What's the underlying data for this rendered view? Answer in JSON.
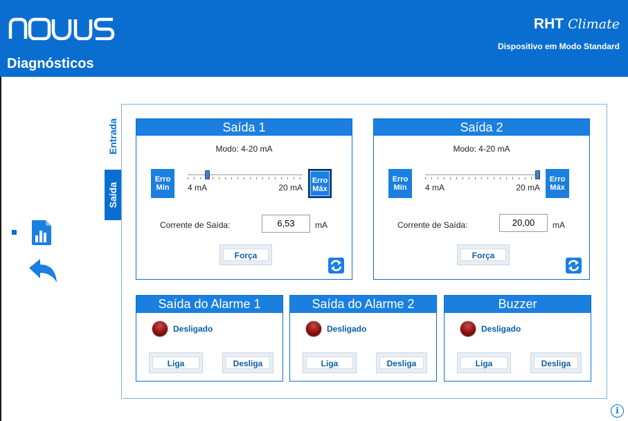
{
  "header": {
    "logo_text": "NOVUS",
    "page_title": "Diagnósticos",
    "product_name": "RHT",
    "product_script": "Climate",
    "device_mode": "Dispositivo em Modo Standard",
    "background_color": "#0a6ed1"
  },
  "tabs": [
    {
      "label": "Entrada",
      "selected": false
    },
    {
      "label": "Saída",
      "selected": true
    }
  ],
  "sidebar": {
    "chart_icon": "bar-chart-icon",
    "back_icon": "back-arrow-icon"
  },
  "outputs": [
    {
      "title": "Saída 1",
      "mode": "Modo: 4-20 mA",
      "error_min": [
        "Erro",
        "Mín"
      ],
      "error_max": [
        "Erro",
        "Máx"
      ],
      "error_max_active": true,
      "slider_min": "4 mA",
      "slider_max": "20 mA",
      "slider_value": 6.53,
      "current_label": "Corrente de Saída:",
      "current_value": "6,53",
      "unit": "mA",
      "force_label": "Força",
      "refresh_icon": "refresh-icon"
    },
    {
      "title": "Saída 2",
      "mode": "Modo: 4-20 mA",
      "error_min": [
        "Erro",
        "Mín"
      ],
      "error_max": [
        "Erro",
        "Máx"
      ],
      "error_max_active": false,
      "slider_min": "4 mA",
      "slider_max": "20 mA",
      "slider_value": 20.0,
      "current_label": "Corrente de Saída:",
      "current_value": "20,00",
      "unit": "mA",
      "force_label": "Força",
      "refresh_icon": "refresh-icon"
    }
  ],
  "alarms": [
    {
      "title": "Saída do Alarme 1",
      "status": "Desligado",
      "on_label": "Liga",
      "off_label": "Desliga"
    },
    {
      "title": "Saída do Alarme 2",
      "status": "Desligado",
      "on_label": "Liga",
      "off_label": "Desliga"
    },
    {
      "title": "Buzzer",
      "status": "Desligado",
      "on_label": "Liga",
      "off_label": "Desliga"
    }
  ],
  "footer": {
    "info_icon": "info-icon",
    "info_glyph": "i"
  },
  "colors": {
    "accent": "#1b7fe0",
    "led_off": "#8a0f0f",
    "text_link": "#0a5ea8"
  }
}
